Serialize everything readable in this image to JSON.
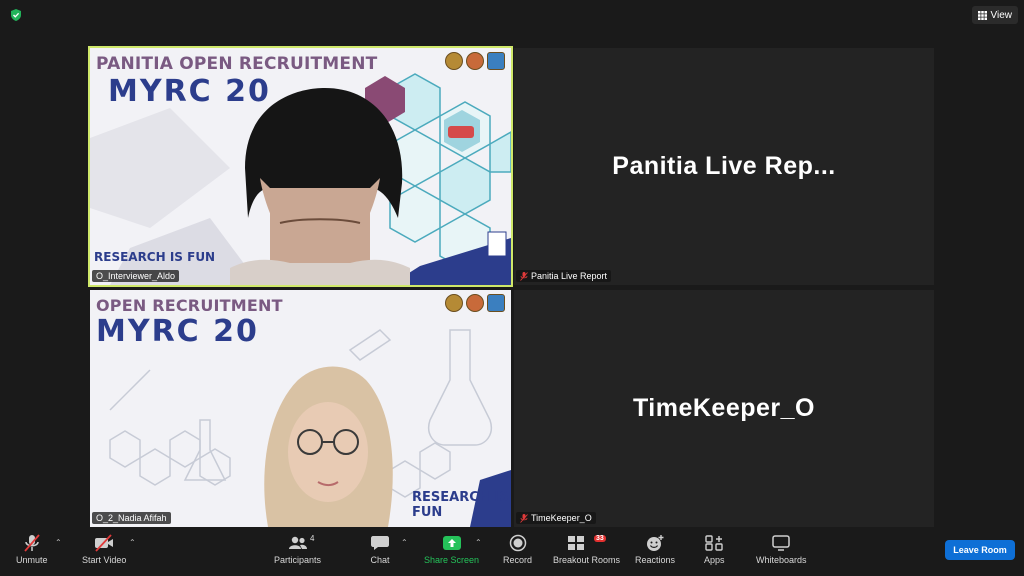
{
  "top": {
    "view_label": "View"
  },
  "tiles": [
    {
      "name": "O_Interviewer_Aldo",
      "slide_title": "PANITIA OPEN RECRUITMENT",
      "slide_brand": "MYRC 20",
      "slide_footer": "RESEARCH IS FUN"
    },
    {
      "name": "Panitia Live Report",
      "display_name": "Panitia  Live  Rep..."
    },
    {
      "name": "O_2_Nadia Afifah",
      "slide_title": "OPEN RECRUITMENT",
      "slide_brand": "MYRC 20",
      "slide_footer": "RESEARCH IS FUN"
    },
    {
      "name": "TimeKeeper_O",
      "display_name": "TimeKeeper_O"
    }
  ],
  "toolbar": {
    "unmute": "Unmute",
    "start_video": "Start Video",
    "participants": "Participants",
    "participants_count": "4",
    "chat": "Chat",
    "share_screen": "Share Screen",
    "record": "Record",
    "breakout_rooms": "Breakout Rooms",
    "breakout_badge": "33",
    "reactions": "Reactions",
    "apps": "Apps",
    "whiteboards": "Whiteboards",
    "leave_room": "Leave Room"
  },
  "colors": {
    "active_speaker_border": "#cfe86a",
    "share_green": "#25c25a",
    "leave_blue": "#0e6fd6",
    "badge_red": "#e3302f"
  }
}
